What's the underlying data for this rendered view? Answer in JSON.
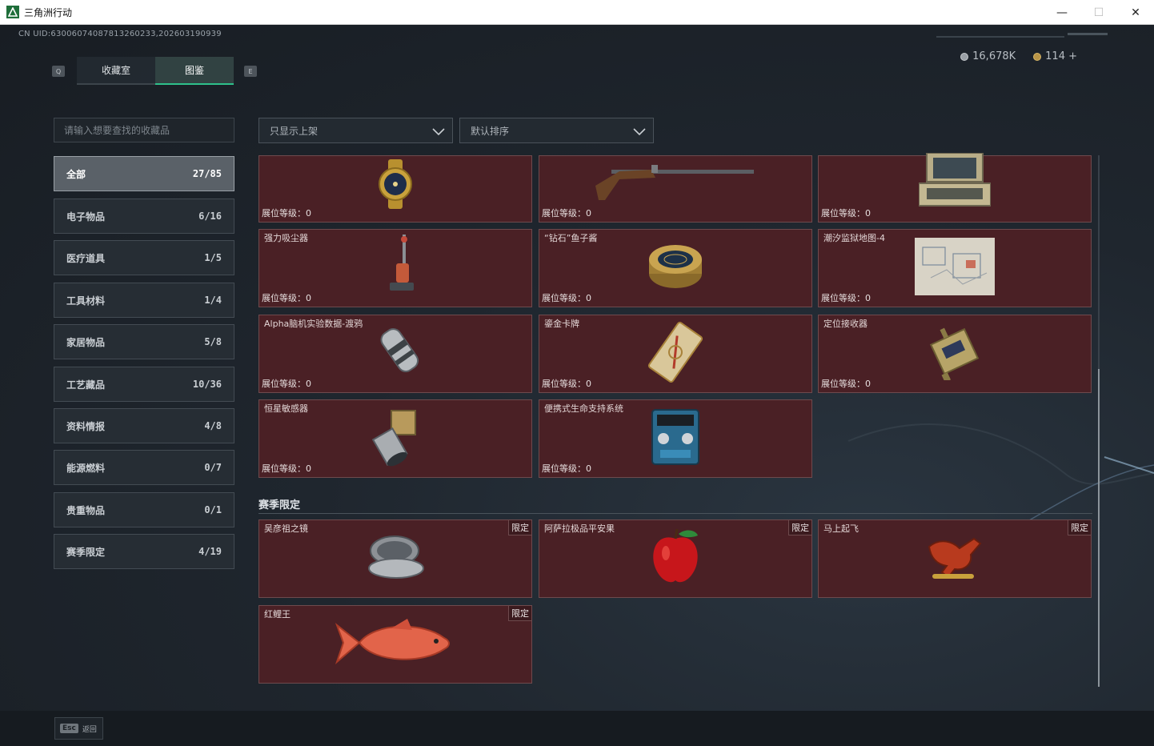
{
  "window": {
    "title": "三角洲行动",
    "minimize": "—",
    "maximize": "☐",
    "close": "✕"
  },
  "header": {
    "uid": "CN UID:63006074087813260233,202603190939",
    "currency": [
      {
        "icon": "silver-coin-icon",
        "value": "16,678K"
      },
      {
        "icon": "gold-coin-icon",
        "value": "114 +"
      }
    ],
    "hint_left": "Q",
    "hint_right": "E",
    "tabs": [
      {
        "label": "收藏室",
        "active": false
      },
      {
        "label": "图鉴",
        "active": true
      }
    ]
  },
  "search": {
    "placeholder": "请输入想要查找的收藏品"
  },
  "filters": {
    "show": "只显示上架",
    "sort": "默认排序"
  },
  "categories": [
    {
      "label": "全部",
      "count": "27/85",
      "active": true
    },
    {
      "label": "电子物品",
      "count": "6/16"
    },
    {
      "label": "医疗道具",
      "count": "1/5"
    },
    {
      "label": "工具材料",
      "count": "1/4"
    },
    {
      "label": "家居物品",
      "count": "5/8"
    },
    {
      "label": "工艺藏品",
      "count": "10/36"
    },
    {
      "label": "资料情报",
      "count": "4/8"
    },
    {
      "label": "能源燃料",
      "count": "0/7"
    },
    {
      "label": "贵重物品",
      "count": "0/1"
    },
    {
      "label": "赛季限定",
      "count": "4/19"
    }
  ],
  "items": [
    {
      "name": "",
      "icon": "gold-watch-icon",
      "level": "展位等级：0"
    },
    {
      "name": "",
      "icon": "musket-icon",
      "level": "展位等级：0"
    },
    {
      "name": "",
      "icon": "rugged-laptop-icon",
      "level": "展位等级：0"
    },
    {
      "name": "强力吸尘器",
      "icon": "vacuum-cleaner-icon",
      "level": "展位等级：0"
    },
    {
      "name": "“钻石”鱼子酱",
      "icon": "caviar-tin-icon",
      "level": "展位等级：0"
    },
    {
      "name": "潮汐监狱地图-4",
      "icon": "map-icon",
      "level": "展位等级：0"
    },
    {
      "name": "Alpha脑机实验数据-渡鸦",
      "icon": "data-capsule-icon",
      "level": "展位等级：0"
    },
    {
      "name": "鎏金卡牌",
      "icon": "gold-card-icon",
      "level": "展位等级：0"
    },
    {
      "name": "定位接收器",
      "icon": "receiver-icon",
      "level": "展位等级：0"
    },
    {
      "name": "恒星敏感器",
      "icon": "star-sensor-icon",
      "level": "展位等级：0"
    },
    {
      "name": "便携式生命支持系统",
      "icon": "life-support-icon",
      "level": "展位等级：0"
    }
  ],
  "season": {
    "title": "赛季限定",
    "limited_label": "限定",
    "items": [
      {
        "name": "吴彦祖之镜",
        "icon": "compact-mirror-icon"
      },
      {
        "name": "阿萨拉极品平安果",
        "icon": "apple-icon"
      },
      {
        "name": "马上起飞",
        "icon": "horse-icon"
      },
      {
        "name": "红鲤王",
        "icon": "carp-icon"
      }
    ]
  },
  "footer": {
    "key": "Esc",
    "label": "返回"
  },
  "colors": {
    "accent": "#2ec08b",
    "card_bg": "#4a2025",
    "card_border": "#6e4a4d"
  }
}
